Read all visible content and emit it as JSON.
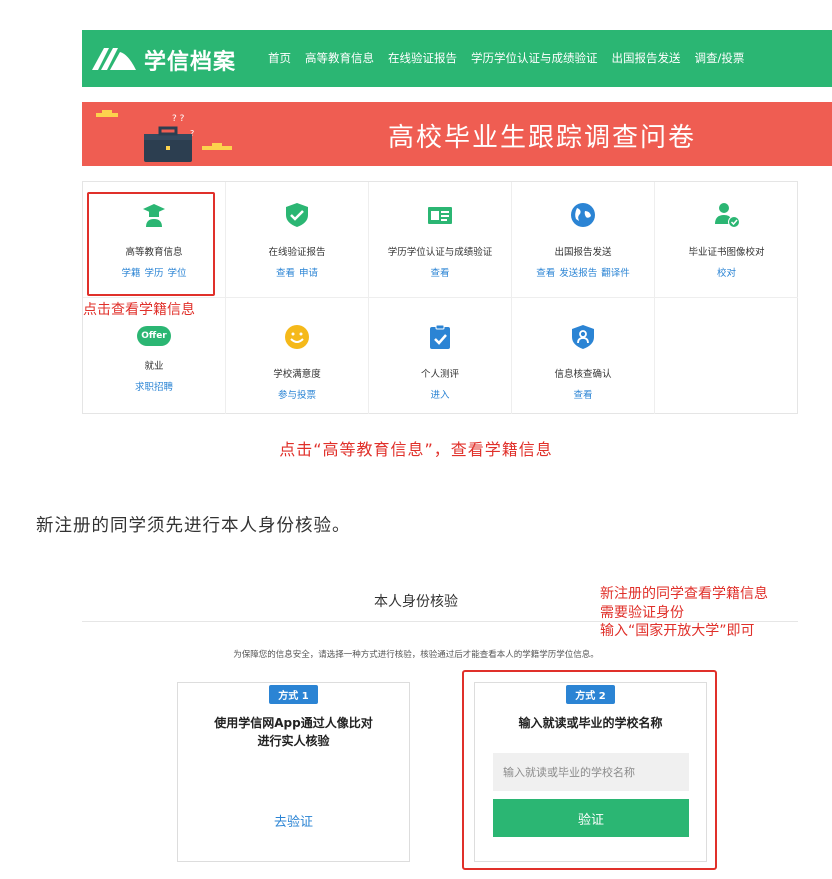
{
  "nav": {
    "logo_text": "学信档案",
    "links": [
      "首页",
      "高等教育信息",
      "在线验证报告",
      "学历学位认证与成绩验证",
      "出国报告发送",
      "调查/投票"
    ]
  },
  "banner": {
    "title": "高校毕业生跟踪调查问卷"
  },
  "grid": {
    "items": [
      {
        "title": "高等教育信息",
        "links": [
          "学籍",
          "学历",
          "学位"
        ],
        "icon": "graduate-icon"
      },
      {
        "title": "在线验证报告",
        "links": [
          "查看",
          "申请"
        ],
        "icon": "shield-check-icon"
      },
      {
        "title": "学历学位认证与成绩验证",
        "links": [
          "查看"
        ],
        "icon": "id-card-icon"
      },
      {
        "title": "出国报告发送",
        "links": [
          "查看",
          "发送报告",
          "翻译件"
        ],
        "icon": "globe-icon"
      },
      {
        "title": "毕业证书图像校对",
        "links": [
          "校对"
        ],
        "icon": "user-check-icon"
      },
      {
        "title": "就业",
        "links": [
          "求职招聘"
        ],
        "icon": "offer-icon"
      },
      {
        "title": "学校满意度",
        "links": [
          "参与投票"
        ],
        "icon": "smiley-icon"
      },
      {
        "title": "个人测评",
        "links": [
          "进入"
        ],
        "icon": "clipboard-check-icon"
      },
      {
        "title": "信息核查确认",
        "links": [
          "查看"
        ],
        "icon": "user-shield-icon"
      }
    ],
    "offer_badge": "Offer"
  },
  "annotations": {
    "note1": "点击查看学籍信息",
    "caption": "点击“高等教育信息”，查看学籍信息",
    "note2_lines": [
      "新注册的同学查看学籍信息",
      "需要验证身份",
      "输入“国家开放大学”即可"
    ]
  },
  "paragraph": "新注册的同学须先进行本人身份核验。",
  "verification": {
    "title": "本人身份核验",
    "hint": "为保障您的信息安全，请选择一种方式进行核验，核验通过后才能查看本人的学籍学历学位信息。",
    "method1": {
      "badge": "方式 1",
      "title_lines": [
        "使用学信网App通过人像比对",
        "进行实人核验"
      ],
      "link": "去验证"
    },
    "method2": {
      "badge": "方式 2",
      "title": "输入就读或毕业的学校名称",
      "input_placeholder": "输入就读或毕业的学校名称",
      "button": "验证"
    }
  },
  "colors": {
    "green": "#2bb673",
    "red": "#ef5d52",
    "blue": "#2b84d4",
    "annotation_red": "#e0302a"
  }
}
